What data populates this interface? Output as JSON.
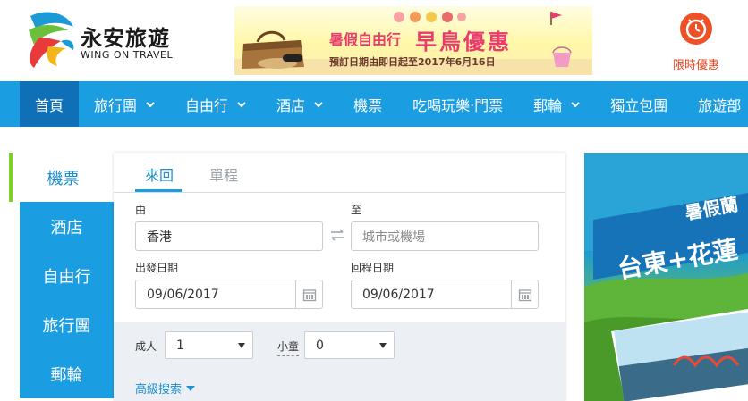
{
  "header": {
    "logo": {
      "cn": "永安旅遊",
      "en": "WING ON TRAVEL"
    },
    "banner": {
      "line1": "暑假自由行",
      "line2": "早鳥優惠",
      "line3": "預訂日期由即日起至2017年6月16日"
    },
    "promo": {
      "label": "限時優惠",
      "icon": "alarm-clock-icon"
    }
  },
  "nav": {
    "items": [
      {
        "label": "首頁",
        "dropdown": false,
        "active": true
      },
      {
        "label": "旅行團",
        "dropdown": true
      },
      {
        "label": "自由行",
        "dropdown": true
      },
      {
        "label": "酒店",
        "dropdown": true
      },
      {
        "label": "機票",
        "dropdown": false
      },
      {
        "label": "吃喝玩樂‧門票",
        "dropdown": false
      },
      {
        "label": "郵輪",
        "dropdown": true
      },
      {
        "label": "獨立包團",
        "dropdown": false
      },
      {
        "label": "旅遊部",
        "dropdown": false
      }
    ]
  },
  "side_tabs": [
    "機票",
    "酒店",
    "自由行",
    "旅行團",
    "郵輪"
  ],
  "search": {
    "trip_tabs": [
      "來回",
      "單程"
    ],
    "from_label": "由",
    "from_value": "香港",
    "to_label": "至",
    "to_placeholder": "城市或機場",
    "depart_label": "出發日期",
    "depart_value": "09/06/2017",
    "return_label": "回程日期",
    "return_value": "09/06/2017",
    "adult_label": "成人",
    "adult_value": "1",
    "child_label": "小童",
    "child_value": "0",
    "advanced": "高級搜索"
  },
  "side_ad": {
    "line1": "暑假蘭",
    "line2": "台東+花蓮"
  },
  "colors": {
    "brand_blue": "#1b9de1",
    "nav_active": "#0f6fb7",
    "promo_red": "#ee5125",
    "banner_pink": "#e83c6f"
  }
}
